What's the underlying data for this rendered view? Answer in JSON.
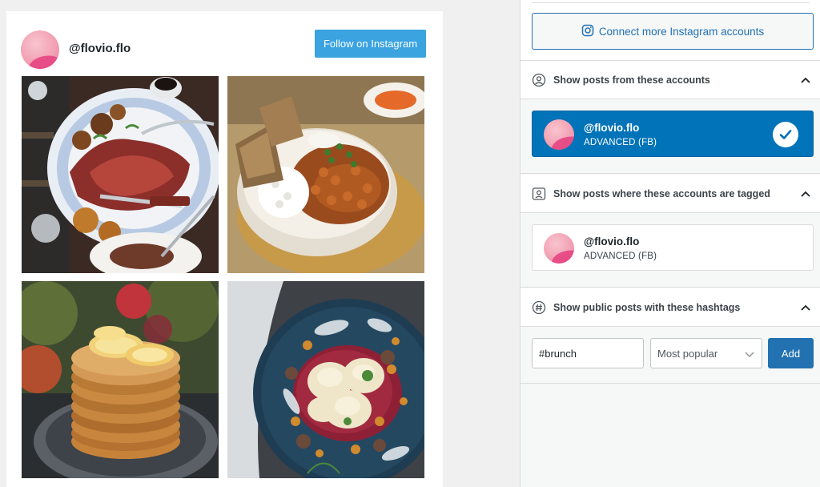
{
  "preview": {
    "username": "@flovio.flo",
    "follow_button": "Follow on Instagram",
    "photos": [
      {
        "icon": "steak-plate-photo"
      },
      {
        "icon": "chickpea-bowl-photo"
      },
      {
        "icon": "pancake-stack-photo"
      },
      {
        "icon": "ravioli-plate-photo"
      }
    ]
  },
  "sidebar": {
    "connect_button": "Connect more Instagram accounts",
    "sections": {
      "accounts": {
        "title": "Show posts from these accounts",
        "account": {
          "name": "@flovio.flo",
          "type": "ADVANCED (FB)",
          "selected": true
        }
      },
      "tagged": {
        "title": "Show posts where these accounts are tagged",
        "account": {
          "name": "@flovio.flo",
          "type": "ADVANCED (FB)",
          "selected": false
        }
      },
      "hashtags": {
        "title": "Show public posts with these hashtags",
        "input_value": "#brunch",
        "sort_selected": "Most popular",
        "add_button": "Add"
      }
    }
  },
  "colors": {
    "follow_blue": "#3aa3e0",
    "selected_blue": "#0073b9",
    "wp_blue": "#2271b1"
  }
}
